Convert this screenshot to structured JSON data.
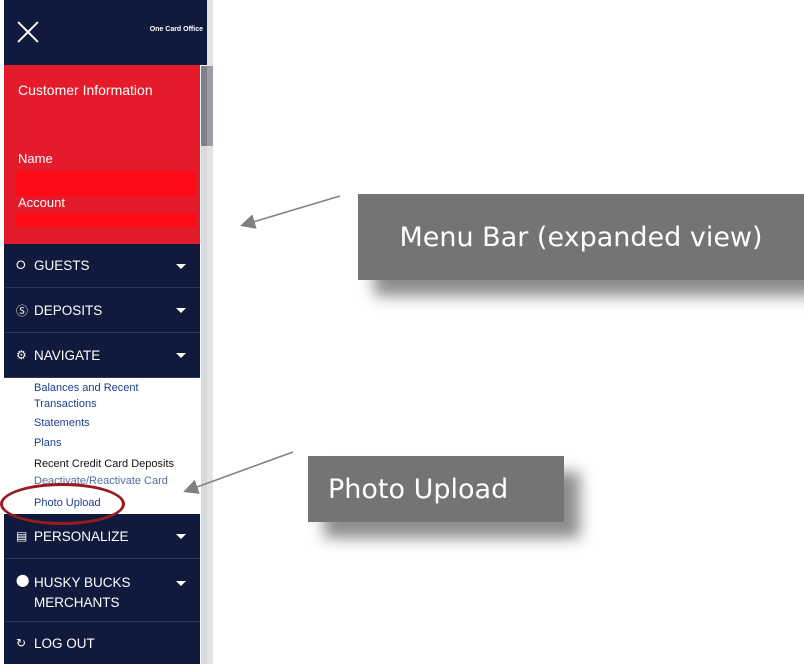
{
  "header": {
    "brand": "One Card Office"
  },
  "customer": {
    "title": "Customer Information",
    "name_label": "Name",
    "account_label": "Account"
  },
  "menu": {
    "guests": "GUESTS",
    "deposits": "DEPOSITS",
    "navigate": "NAVIGATE",
    "personalize": "PERSONALIZE",
    "husky_line1": "HUSKY BUCKS",
    "husky_line2": "MERCHANTS",
    "logout": "LOG OUT"
  },
  "submenu": {
    "items": [
      "Balances and Recent",
      "Transactions",
      "Statements",
      "Plans",
      "Recent Credit Card Deposits",
      "Deactivate/Reactivate Card",
      "Photo Upload"
    ]
  },
  "callouts": {
    "menu_bar": "Menu Bar (expanded view)",
    "photo_upload": "Photo Upload"
  },
  "colors": {
    "navy": "#0f1a3c",
    "red": "#e31b2a",
    "callout": "#747474",
    "highlight_circle": "#9a1b1b"
  }
}
